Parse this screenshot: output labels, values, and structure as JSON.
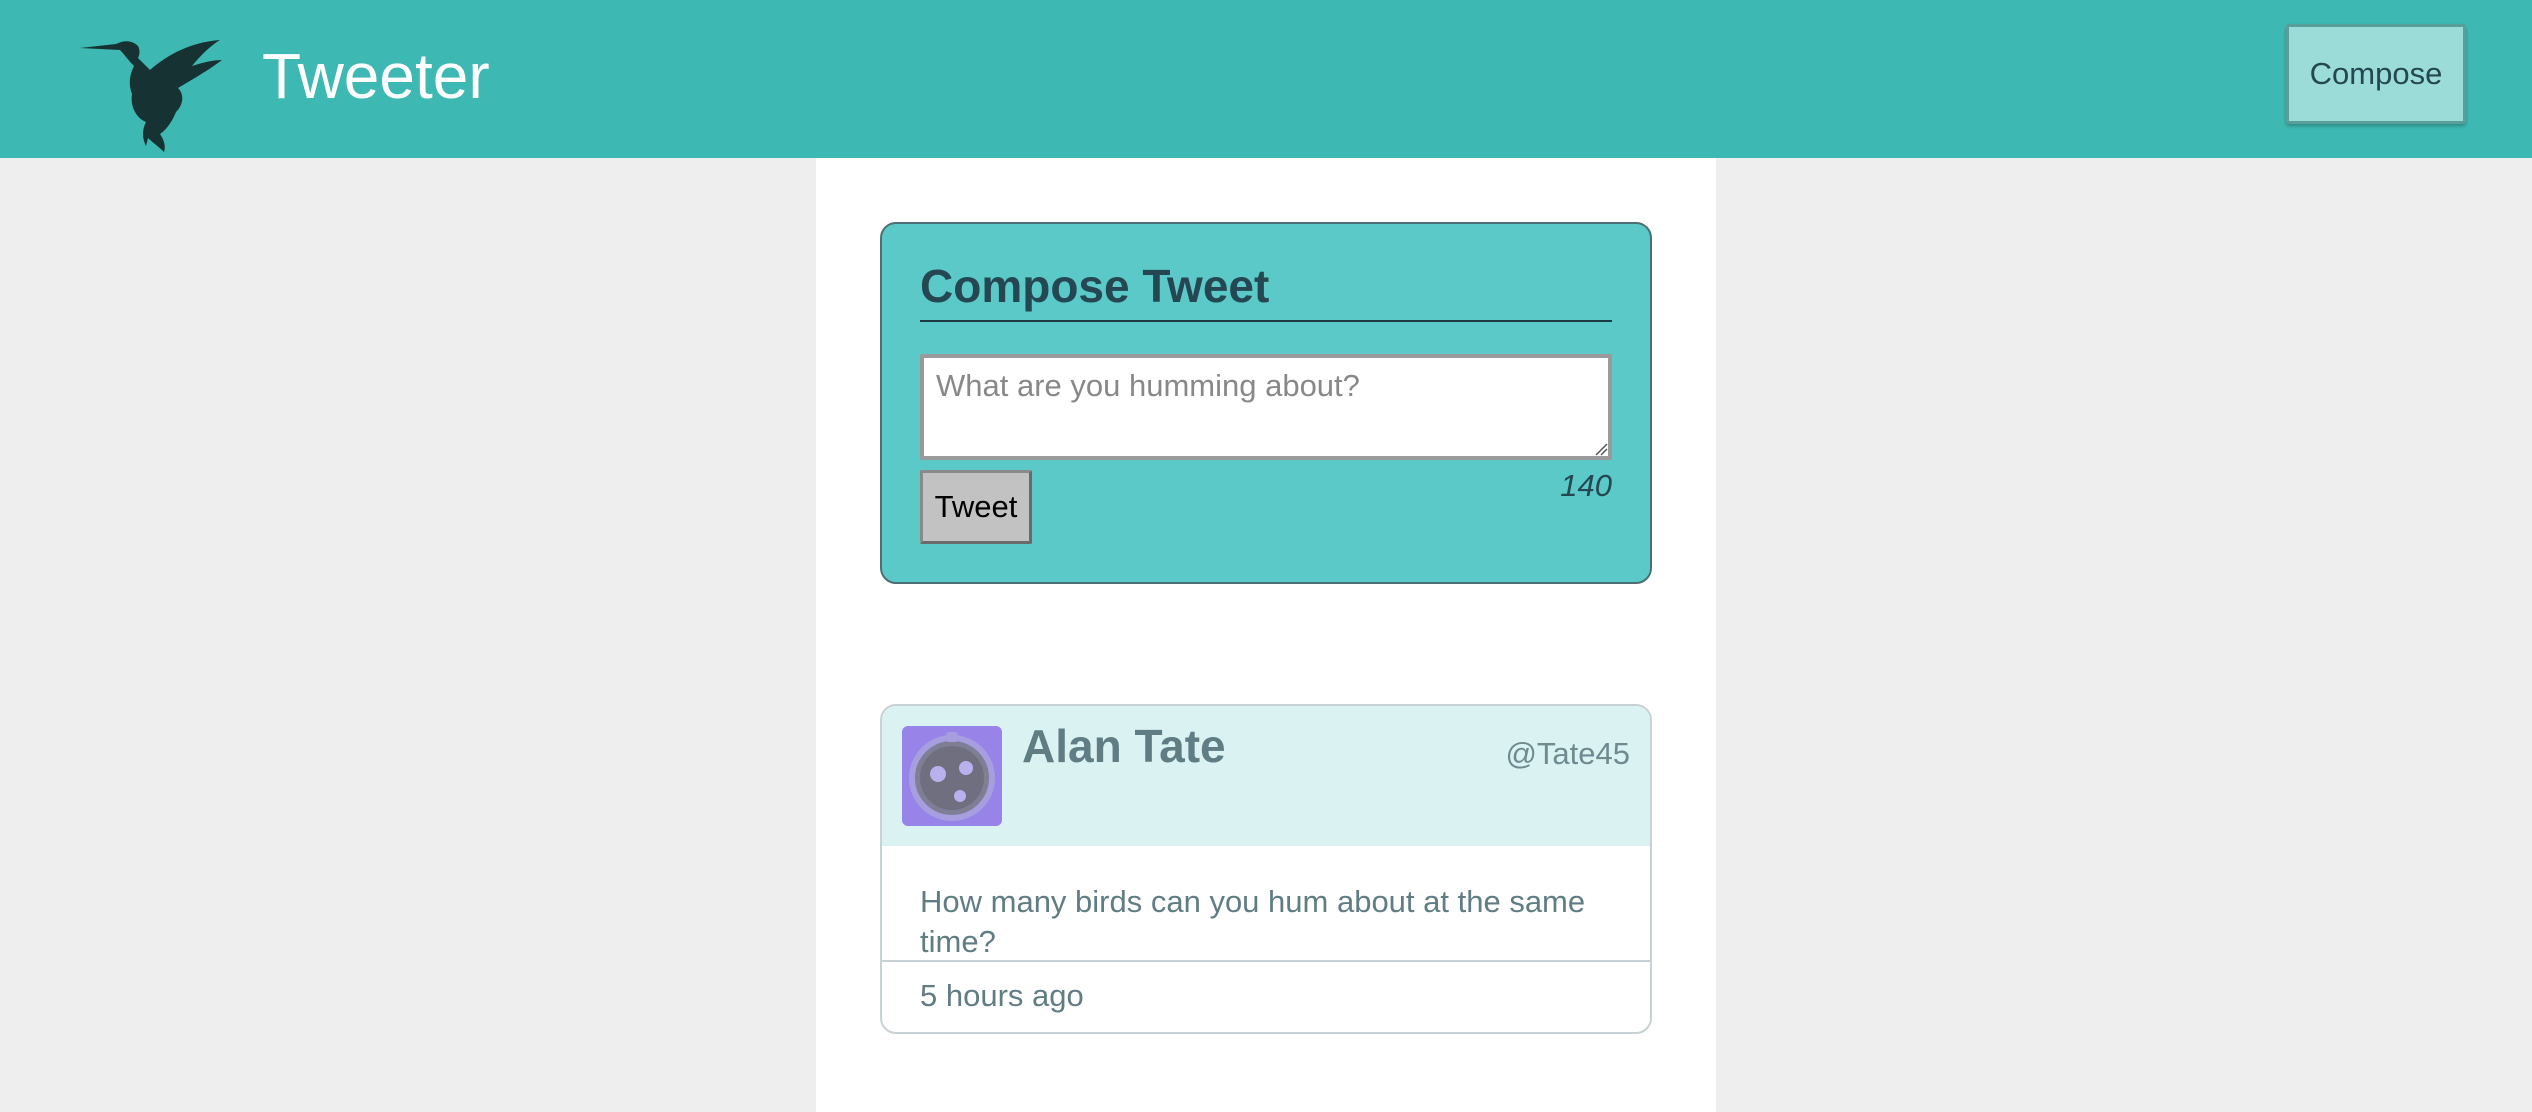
{
  "nav": {
    "logo_icon": "hummingbird-icon",
    "title": "Tweeter",
    "compose_button_label": "Compose"
  },
  "compose": {
    "heading": "Compose Tweet",
    "textarea_placeholder": "What are you humming about?",
    "textarea_value": "",
    "tweet_button_label": "Tweet",
    "char_counter": "140"
  },
  "tweets": [
    {
      "name": "Alan Tate",
      "handle": "@Tate45",
      "avatar_icon": "user-avatar-icon",
      "content": "How many birds can you hum about at the same time?",
      "timestamp": "5 hours ago"
    }
  ],
  "colors": {
    "nav_background": "#3db8b2",
    "page_background": "#eeeeee",
    "compose_background": "#5cc9c9",
    "tweet_header_background": "#daf2f2",
    "avatar_background": "#9884e8",
    "compose_nav_button": "#9bdcd8"
  }
}
